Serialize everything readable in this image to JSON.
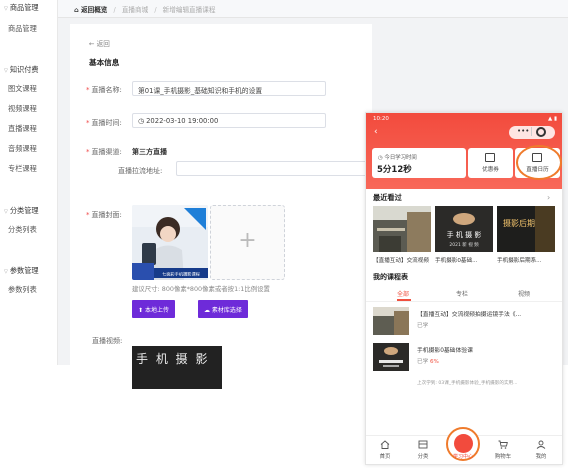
{
  "sidebar": {
    "groups": [
      {
        "title": "商品管理",
        "items": [
          "商品管理"
        ]
      },
      {
        "title": "知识付费",
        "items": [
          "图文课程",
          "视频课程",
          "直播课程",
          "音频课程",
          "专栏课程"
        ]
      },
      {
        "title": "分类管理",
        "items": [
          "分类列表"
        ]
      },
      {
        "title": "参数管理",
        "items": [
          "参数列表"
        ]
      }
    ]
  },
  "breadcrumb": {
    "home": "返回概览",
    "parent": "直播商城",
    "current": "新增编辑直播课程"
  },
  "form": {
    "back": "返回",
    "section_title": "基本信息",
    "name_label": "直播名称:",
    "name_value": "第01课_手机摄影_基础知识和手机的设置",
    "time_label": "直播时间:",
    "time_value": "2022-03-10 19:00:00",
    "channel_label": "直播渠道:",
    "channel_value": "第三方直播",
    "push_label": "直播拉流地址:",
    "cover_label": "直播封面:",
    "cover_banner": "七面彩手机摄影课程",
    "cover_hint": "建议尺寸: 800像素*800像素或者按1:1比例设置",
    "upload_local": "本地上传",
    "upload_library": "素材库选择",
    "video_label": "直播视频:",
    "video_thumb_text": "手 机 摄 影"
  },
  "phone": {
    "time": "10:20",
    "status": "▲ ▮",
    "study_label": "今日学习时间",
    "study_value": "5分12秒",
    "coupon_label": "优惠券",
    "calendar_label": "直播日历",
    "recent_title": "最近看过",
    "recent_more": "›",
    "recent": [
      {
        "caption": "【直播互动】交流视频",
        "thumb_text": ""
      },
      {
        "caption": "手机摄影0基础...",
        "thumb_text": "手 机 摄 影"
      },
      {
        "caption": "手机摄影后期系...",
        "thumb_text": "摄影后期"
      }
    ],
    "recent_thumb_subtitle": "2021 新 视 频",
    "my_title": "我的课程表",
    "tabs": [
      "全部",
      "专栏",
      "视频"
    ],
    "courses": [
      {
        "title": "【直播互动】交流视频拍摄运镜手法《...",
        "meta_prefix": "已学",
        "meta_pct": ""
      },
      {
        "title": "手机摄影0基础体验课",
        "meta_prefix": "已学",
        "meta_pct": "6%"
      }
    ],
    "course_footer": "上次学到: 03课_手机摄影体验_手机摄影的实用...",
    "nav": [
      "首页",
      "分类",
      "学习中心",
      "购物车",
      "我的"
    ]
  },
  "colors": {
    "accent_purple": "#6e2bd9",
    "phone_red": "#f24b3d",
    "highlight_orange": "#ef7b2c"
  }
}
